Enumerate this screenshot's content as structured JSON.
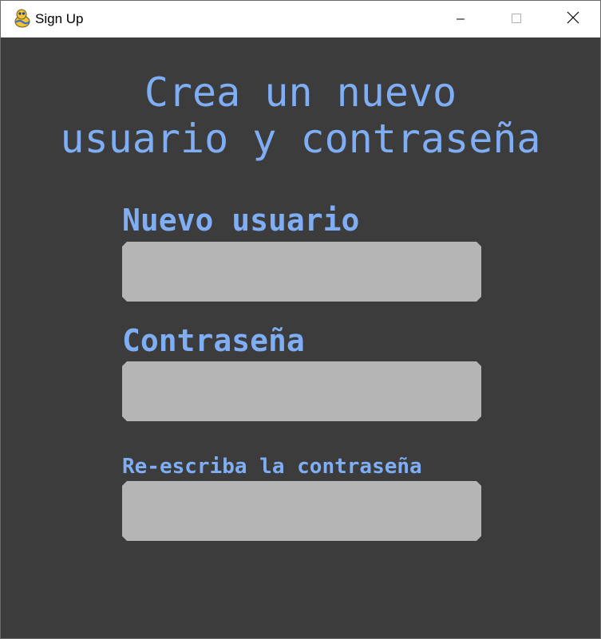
{
  "window": {
    "title": "Sign Up",
    "app_icon": "pygame-snake-icon",
    "controls": {
      "minimize_icon": "minimize-icon",
      "maximize_icon": "maximize-icon",
      "close_icon": "close-icon"
    }
  },
  "form": {
    "heading": "Crea un nuevo\nusuario y contraseña",
    "username": {
      "label": "Nuevo usuario",
      "value": ""
    },
    "password": {
      "label": "Contraseña",
      "value": ""
    },
    "confirm_password": {
      "label": "Re-escriba la contraseña",
      "value": ""
    }
  },
  "colors": {
    "background": "#3c3c3c",
    "accent_text": "#7faef5",
    "field_fill": "#b5b5b5",
    "titlebar": "#ffffff"
  }
}
